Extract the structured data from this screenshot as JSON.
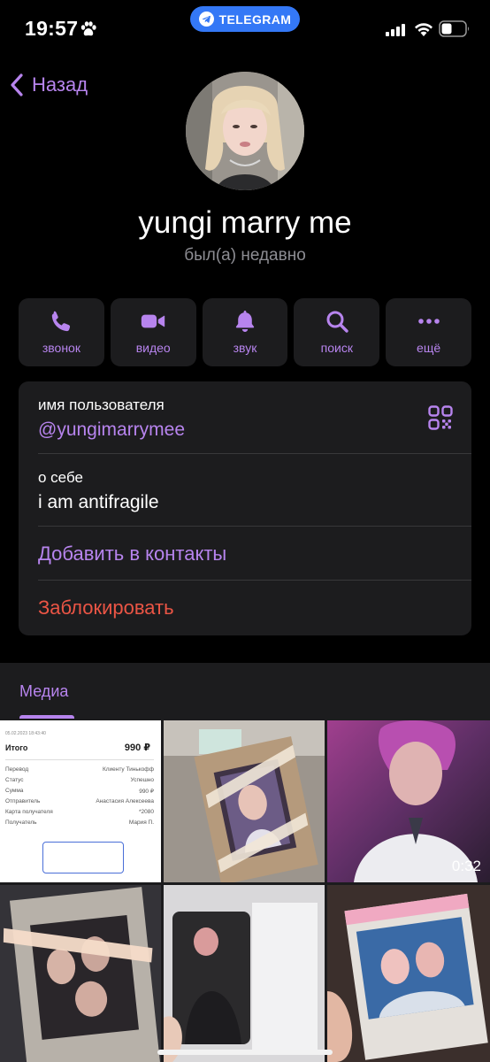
{
  "status_bar": {
    "time": "19:57",
    "pill_label": "TELEGRAM",
    "icons": [
      "paw-icon",
      "signal-icon",
      "wifi-icon",
      "battery-icon"
    ]
  },
  "nav": {
    "back_label": "Назад"
  },
  "profile": {
    "name": "yungi marry me",
    "status": "был(а) недавно"
  },
  "actions": [
    {
      "label": "звонок",
      "icon": "phone-icon"
    },
    {
      "label": "видео",
      "icon": "video-icon"
    },
    {
      "label": "звук",
      "icon": "bell-icon"
    },
    {
      "label": "поиск",
      "icon": "search-icon"
    },
    {
      "label": "ещё",
      "icon": "more-icon"
    }
  ],
  "info": {
    "username_label": "имя пользователя",
    "username_value": "@yungimarrymee",
    "bio_label": "о себе",
    "bio_value": "i am antifragile",
    "add_contact": "Добавить в контакты",
    "block": "Заблокировать"
  },
  "media": {
    "tab_label": "Медиа",
    "video_duration": "0:32",
    "receipt": {
      "date": "05.02.2023  18:43:40",
      "total_label": "Итого",
      "total_amount": "990 ₽",
      "rows": [
        {
          "k": "Перевод",
          "v": "Клиенту Тинькофф"
        },
        {
          "k": "Статус",
          "v": "Успешно"
        },
        {
          "k": "Сумма",
          "v": "990 ₽"
        },
        {
          "k": "Отправитель",
          "v": "Анастасия Алексеева"
        },
        {
          "k": "Карта получателя",
          "v": "*2080"
        },
        {
          "k": "Получатель",
          "v": "Мария П."
        }
      ]
    }
  },
  "colors": {
    "accent": "#b784ee",
    "danger": "#eb5545",
    "card": "#1c1c1e",
    "telegram_pill": "#3478f6"
  }
}
